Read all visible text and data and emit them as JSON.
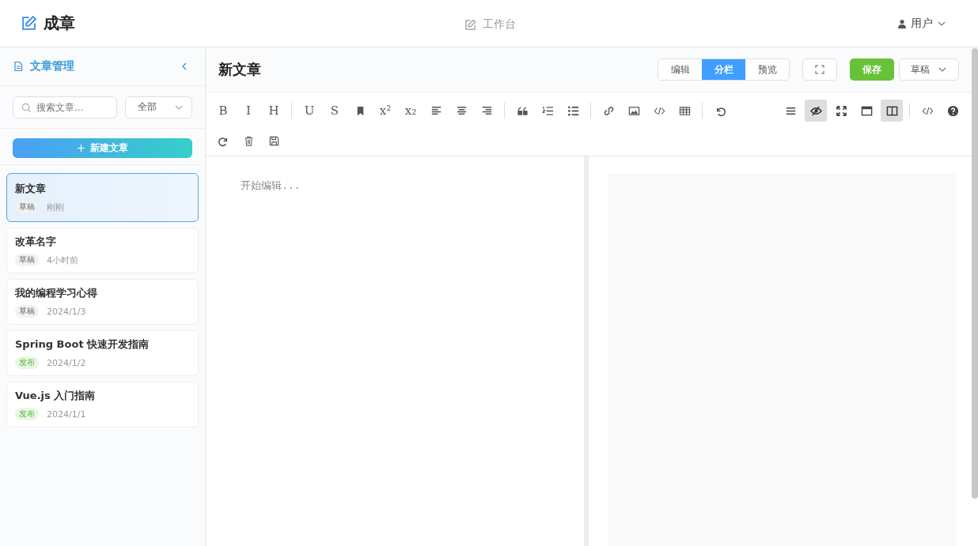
{
  "header": {
    "logo": "成章",
    "nav": "工作台",
    "user": "用户"
  },
  "sidebar": {
    "title": "文章管理",
    "search": {
      "placeholder": "搜索文章..."
    },
    "filter": "全部",
    "new_button": "新建文章",
    "articles": [
      {
        "title": "新文章",
        "status": "草稿",
        "kind": "draft",
        "time": "刚刚",
        "selected": true
      },
      {
        "title": "改革名字",
        "status": "草稿",
        "kind": "draft",
        "time": "4小时前",
        "selected": false
      },
      {
        "title": "我的编程学习心得",
        "status": "草稿",
        "kind": "draft",
        "time": "2024/1/3",
        "selected": false
      },
      {
        "title": "Spring Boot 快速开发指南",
        "status": "发布",
        "kind": "published",
        "time": "2024/1/2",
        "selected": false
      },
      {
        "title": "Vue.js 入门指南",
        "status": "发布",
        "kind": "published",
        "time": "2024/1/1",
        "selected": false
      }
    ]
  },
  "editor": {
    "title": "新文章",
    "modes": [
      {
        "label": "编辑",
        "selected": false
      },
      {
        "label": "分栏",
        "selected": true
      },
      {
        "label": "预览",
        "selected": false
      }
    ],
    "save": "保存",
    "status_select": "草稿",
    "toolbar": {
      "left": [
        {
          "kind": "glyph",
          "glyph": "B"
        },
        {
          "kind": "glyph",
          "glyph": "I"
        },
        {
          "kind": "glyph",
          "glyph": "H"
        },
        {
          "kind": "divider"
        },
        {
          "kind": "glyph",
          "glyph": "U"
        },
        {
          "kind": "glyph",
          "glyph": "S"
        },
        {
          "kind": "bookmark"
        },
        {
          "kind": "glyph",
          "glyph": "x²"
        },
        {
          "kind": "glyph",
          "glyph": "x₂"
        },
        {
          "kind": "align-left"
        },
        {
          "kind": "align-center"
        },
        {
          "kind": "align-right"
        },
        {
          "kind": "divider"
        },
        {
          "kind": "quote"
        },
        {
          "kind": "ordered-list"
        },
        {
          "kind": "bullet-list"
        },
        {
          "kind": "divider"
        },
        {
          "kind": "link"
        },
        {
          "kind": "image"
        },
        {
          "kind": "code"
        },
        {
          "kind": "table"
        },
        {
          "kind": "divider"
        },
        {
          "kind": "undo"
        }
      ],
      "right": [
        {
          "kind": "menu",
          "active": false
        },
        {
          "kind": "eye",
          "active": true
        },
        {
          "kind": "expand",
          "active": false
        },
        {
          "kind": "window",
          "active": false
        },
        {
          "kind": "columns",
          "active": true
        },
        {
          "kind": "divider"
        },
        {
          "kind": "code",
          "active": false
        },
        {
          "kind": "help",
          "active": false
        }
      ],
      "second_row": [
        {
          "kind": "redo"
        },
        {
          "kind": "trash"
        },
        {
          "kind": "save"
        }
      ]
    },
    "placeholder": "开始编辑..."
  }
}
